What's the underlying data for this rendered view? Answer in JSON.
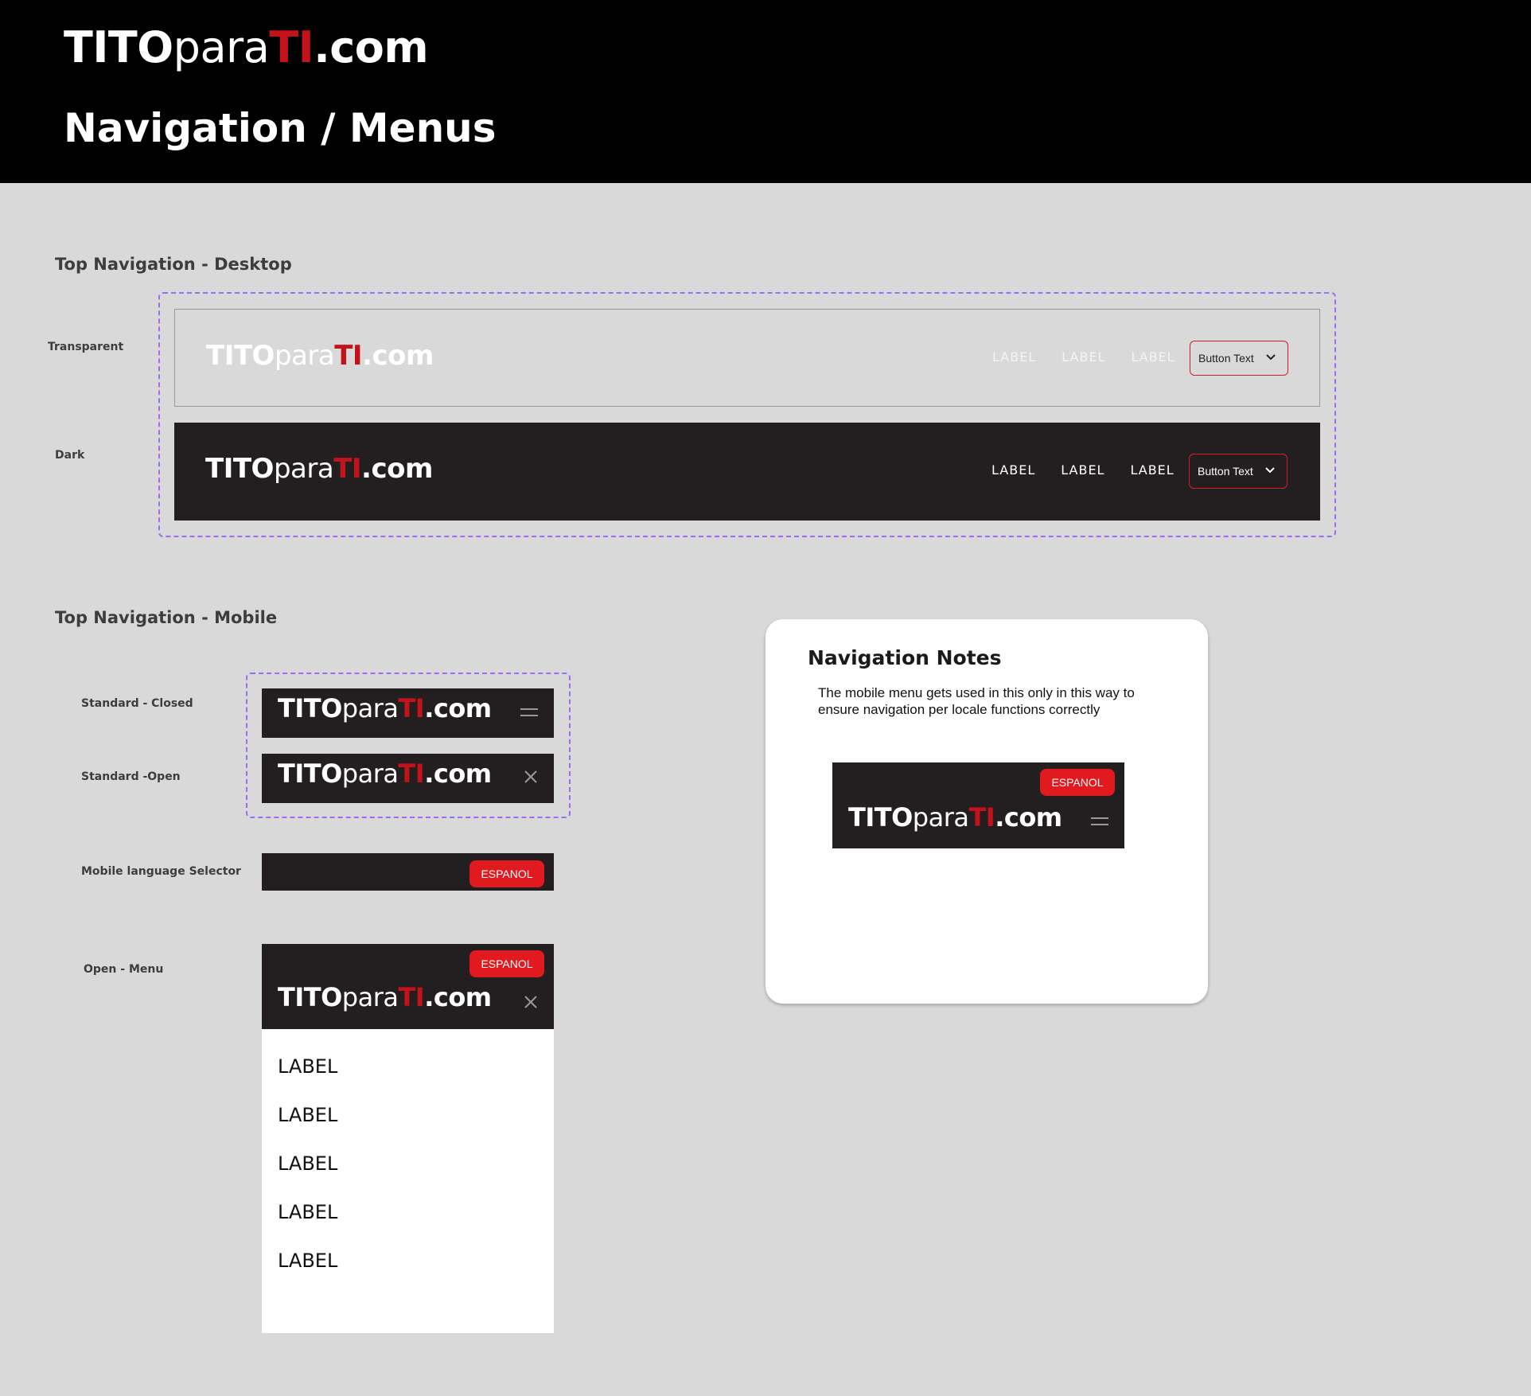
{
  "header": {
    "logo": {
      "part1": "TITO",
      "part2": "para",
      "part3": "TI",
      "part4": ".com"
    },
    "title": "Navigation / Menus"
  },
  "desktop": {
    "section_title": "Top Navigation - Desktop",
    "transparent_label": "Transparent",
    "dark_label": "Dark",
    "links": [
      "LABEL",
      "LABEL",
      "LABEL"
    ],
    "button_text": "Button Text"
  },
  "mobile": {
    "section_title": "Top Navigation - Mobile",
    "closed_label": "Standard - Closed",
    "open_label": "Standard -Open",
    "lang_label": "Mobile language Selector",
    "menu_label": "Open - Menu",
    "lang_button": "ESPANOL",
    "menu_items": [
      "LABEL",
      "LABEL",
      "LABEL",
      "LABEL",
      "LABEL"
    ]
  },
  "notes": {
    "title": "Navigation Notes",
    "text": "The mobile menu gets used in this only in this way to ensure navigation per locale functions correctly",
    "lang_button": "ESPANOL"
  },
  "colors": {
    "brand_red": "#c4121a",
    "button_red": "#e01a1f",
    "dark_bar": "#231f20",
    "dashed_outline": "#9b6cf5"
  }
}
